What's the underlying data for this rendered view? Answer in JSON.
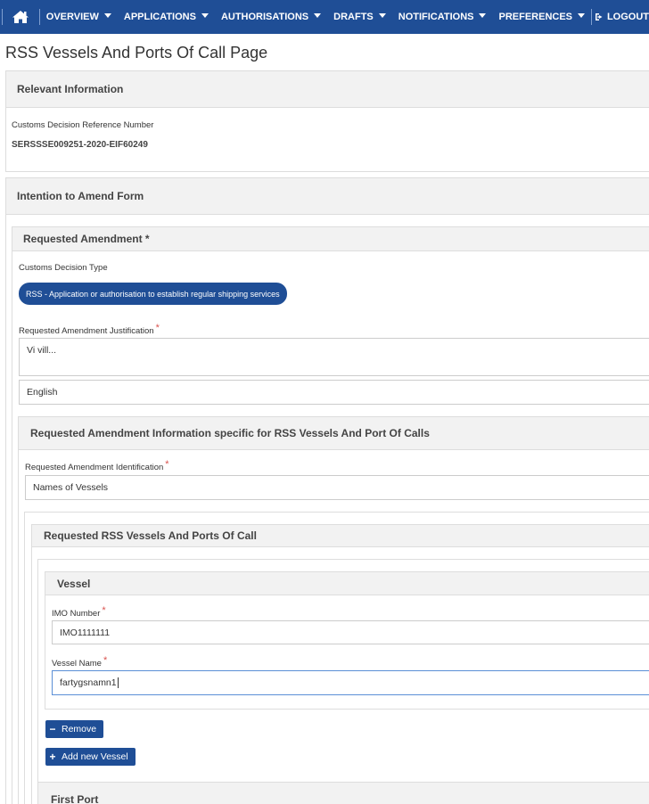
{
  "nav": {
    "home_icon": "home-icon",
    "items": [
      {
        "label": "OVERVIEW"
      },
      {
        "label": "APPLICATIONS"
      },
      {
        "label": "AUTHORISATIONS"
      },
      {
        "label": "DRAFTS"
      },
      {
        "label": "NOTIFICATIONS"
      },
      {
        "label": "PREFERENCES"
      }
    ],
    "logout_label": "LOGOUT",
    "logout_icon": "sign-out-icon"
  },
  "page": {
    "title": "RSS Vessels And Ports Of Call Page"
  },
  "relevant_info": {
    "heading": "Relevant Information",
    "ref_label": "Customs Decision Reference Number",
    "ref_value": "SERSSSE009251-2020-EIF60249"
  },
  "intention_form": {
    "heading": "Intention to Amend Form",
    "requested_amendment": {
      "heading": "Requested Amendment *",
      "decision_type_label": "Customs Decision Type",
      "decision_type_value": "RSS - Application or authorisation to establish regular shipping services",
      "justification_label": "Requested Amendment Justification",
      "justification_value": "Vi vill...",
      "language_value": "English"
    },
    "specific_info": {
      "heading": "Requested Amendment Information specific for RSS Vessels And Port Of Calls",
      "identification_label": "Requested Amendment Identification",
      "identification_value": "Names of Vessels",
      "vessels_ports": {
        "heading": "Requested RSS Vessels And Ports Of Call",
        "vessel": {
          "heading": "Vessel",
          "imo_label": "IMO Number",
          "imo_value": "IMO1111111",
          "name_label": "Vessel Name",
          "name_value": "fartygsnamn1"
        },
        "remove_label": "Remove",
        "add_vessel_label": "Add new Vessel",
        "first_port_heading": "First Port"
      }
    }
  },
  "colors": {
    "brand": "#1f4e96",
    "required": "#d9534f"
  }
}
